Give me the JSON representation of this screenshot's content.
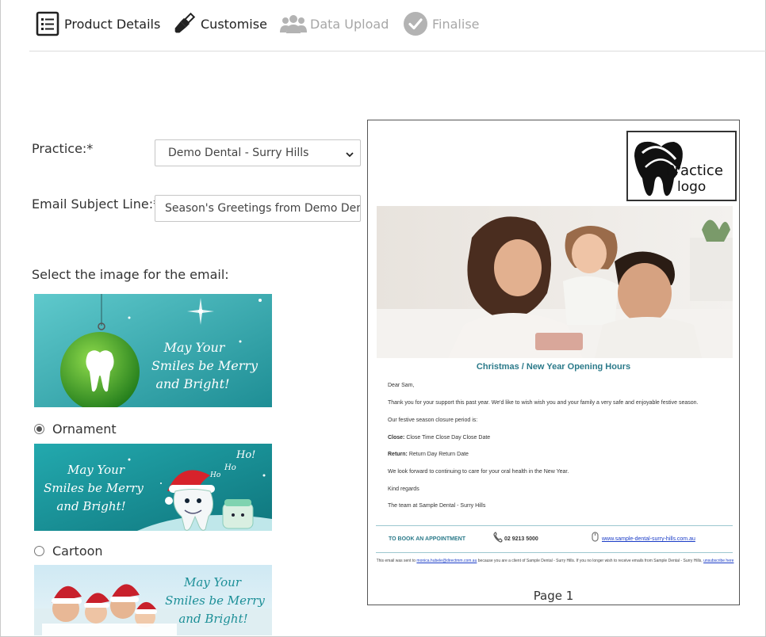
{
  "steps": [
    {
      "label": "Product Details",
      "state": "active",
      "icon": "list-icon"
    },
    {
      "label": "Customise",
      "state": "active",
      "icon": "brush-icon"
    },
    {
      "label": "Data Upload",
      "state": "inactive",
      "icon": "users-icon"
    },
    {
      "label": "Finalise",
      "state": "inactive",
      "icon": "check-circle-icon"
    }
  ],
  "form": {
    "practice_label": "Practice:*",
    "practice_value": "Demo Dental - Surry Hills",
    "subject_label": "Email Subject Line:*",
    "subject_value": "Season's Greetings from Demo Dental",
    "image_label": "Select the image for the email:"
  },
  "image_options": [
    {
      "label": "Ornament",
      "selected": true,
      "banner_text": [
        "May Your",
        "Smiles be Merry",
        "and Bright!"
      ]
    },
    {
      "label": "Cartoon",
      "selected": false,
      "banner_text": [
        "May Your",
        "Smiles be Merry",
        "and Bright!"
      ],
      "extra": [
        "Ho!",
        "Ho",
        "Ho"
      ]
    },
    {
      "label": "",
      "selected": false,
      "banner_text": [
        "May Your",
        "Smiles be Merry",
        "and Bright!"
      ]
    }
  ],
  "preview": {
    "logo_text": [
      "Practice",
      "logo"
    ],
    "title": "Christmas / New Year Opening Hours",
    "greeting": "Dear Sam,",
    "body1": "Thank you for your support this past year. We'd like to wish wish you and your family a very safe and enjoyable festive season.",
    "body2": "Our festive season closure period is:",
    "close_label": "Close:",
    "close_value": "Close Time Close Day Close Date",
    "return_label": "Return:",
    "return_value": "Return Day Return Date",
    "body3": "We look forward to continuing to care for your oral health in the New Year.",
    "signoff": "Kind regards",
    "signature": "The team at Sample Dental - Surry Hills",
    "book_label": "TO BOOK AN APPOINTMENT",
    "phone": "02 9213 5000",
    "website": "www.sample-dental-surry-hills.com.au",
    "footer_pre": "This email was sent to",
    "footer_email": "monica.hubele@directmm.com.au",
    "footer_mid": "because you are a client of Sample Dental - Surry Hills. If you no longer wish to receive emails from Sample Dental - Surry Hills,",
    "footer_unsub": "unsubscribe here",
    "page_label": "Page 1"
  },
  "colors": {
    "accent": "#2b7a8a",
    "teal_banner": "#3aa9ae",
    "link": "#1a3cc7"
  }
}
